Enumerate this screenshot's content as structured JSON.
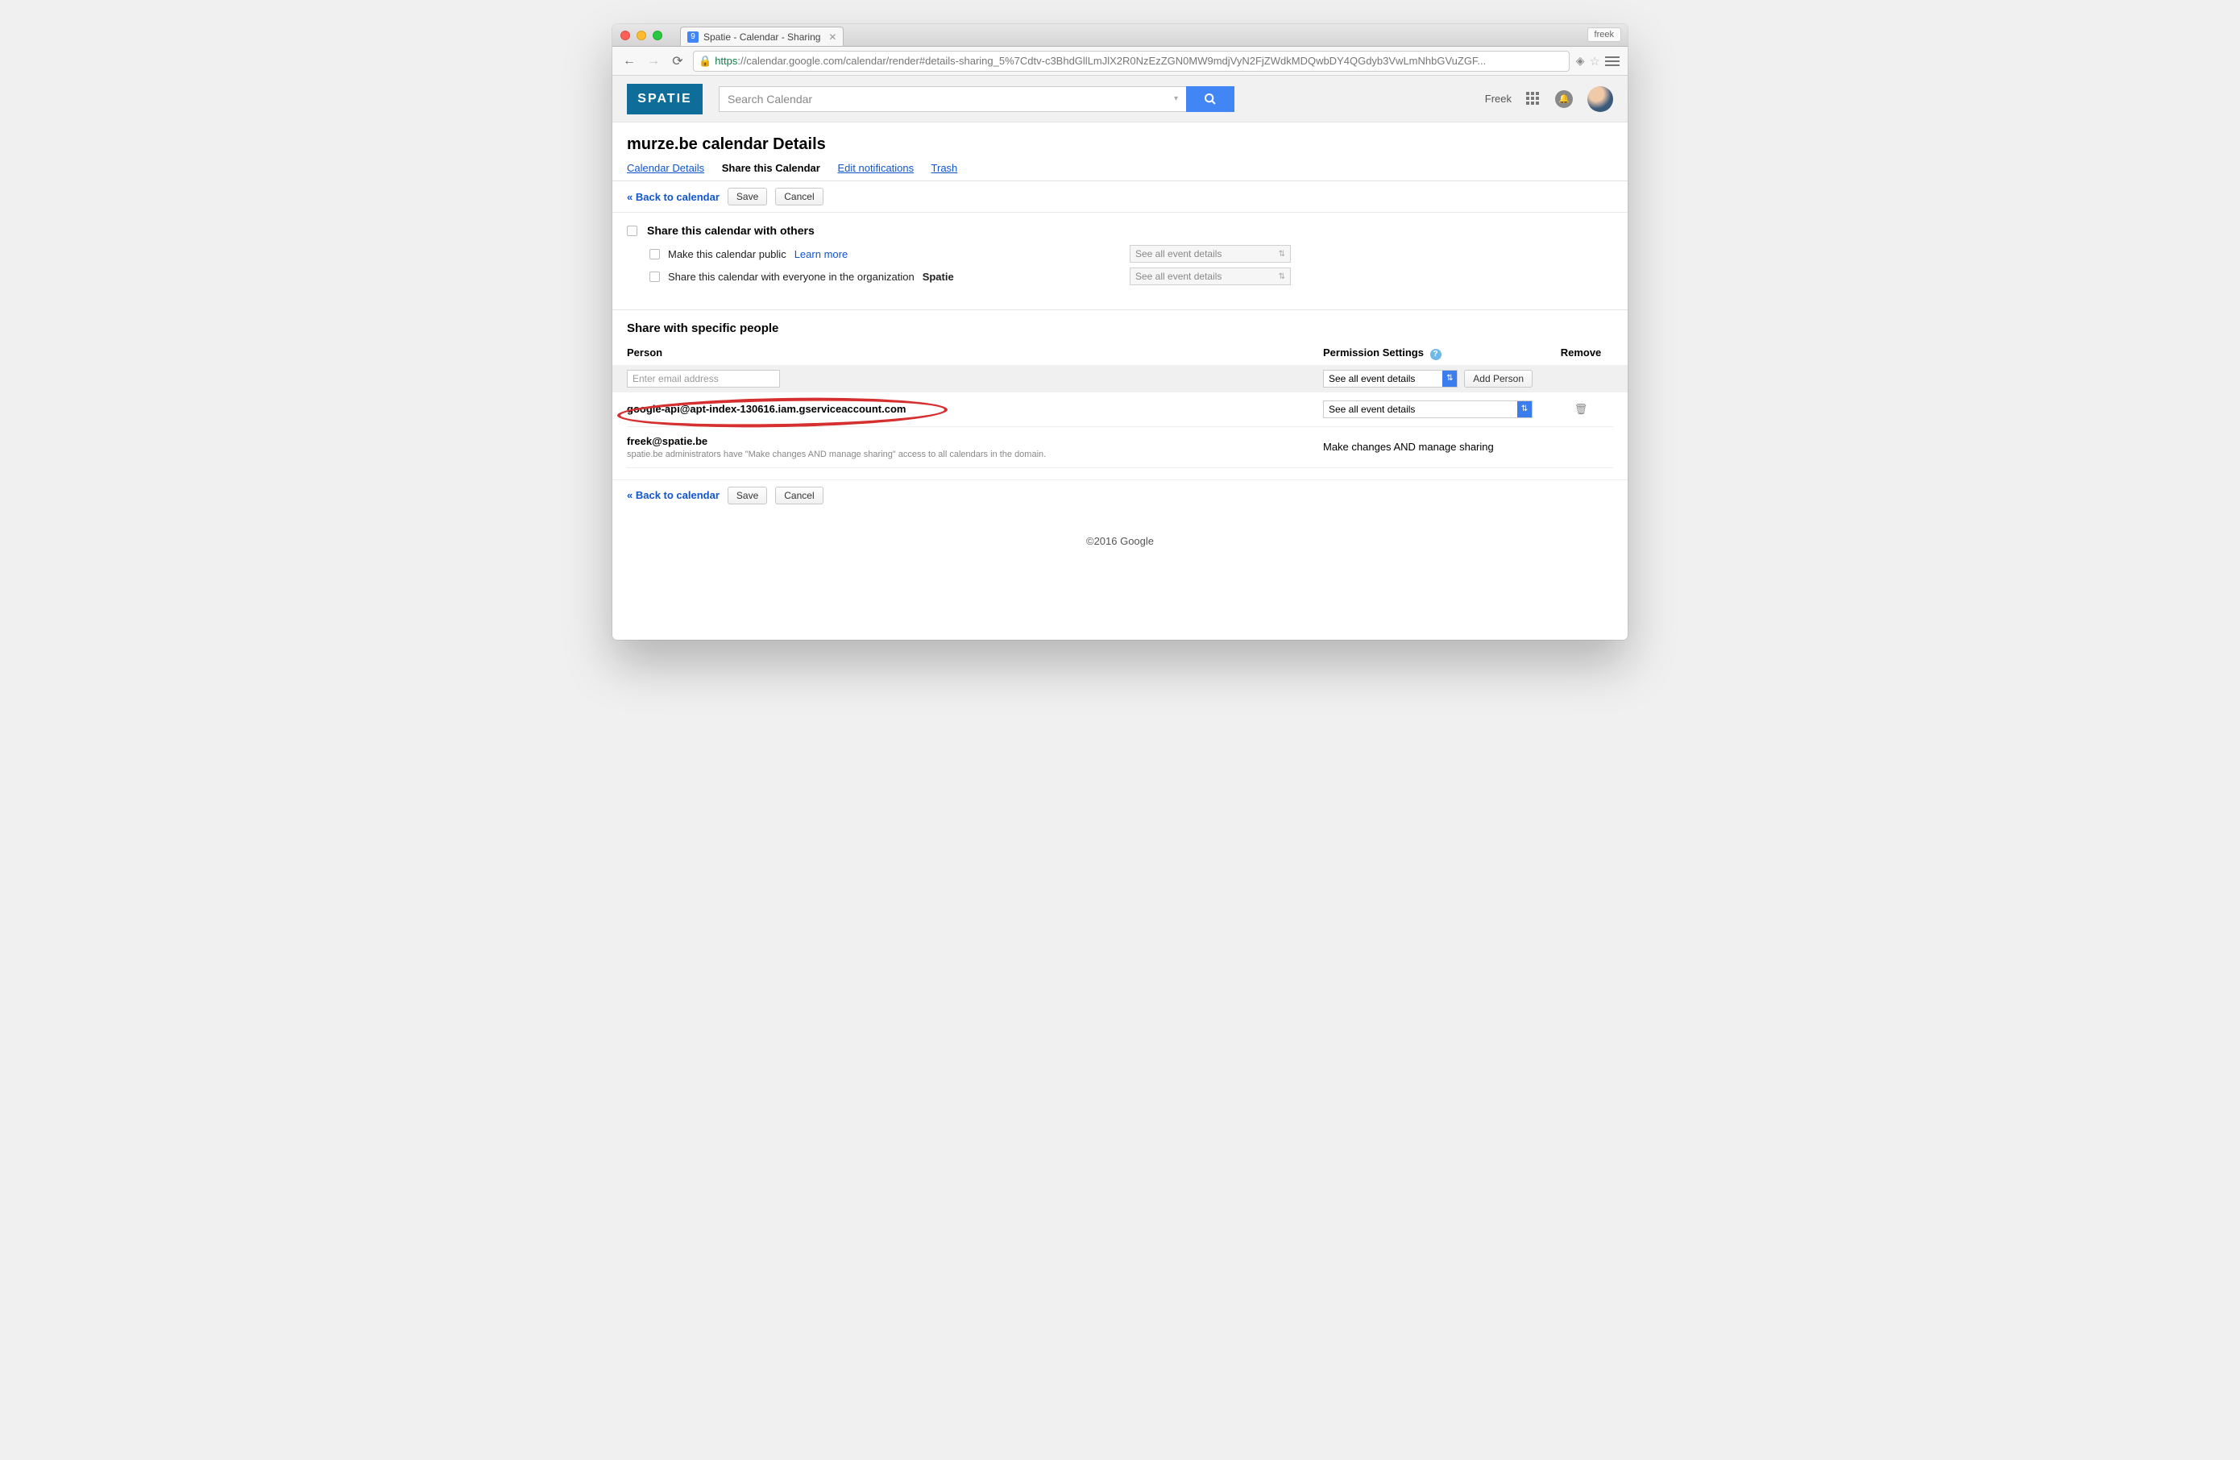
{
  "chrome": {
    "profile_name": "freek",
    "tab": {
      "badge": "9",
      "title": "Spatie - Calendar - Sharing"
    },
    "url_secure_part": "https",
    "url_host": "://calendar.google.com",
    "url_path": "/calendar/render#details-sharing_5%7Cdtv-c3BhdGllLmJlX2R0NzEzZGN0MW9mdjVyN2FjZWdkMDQwbDY4QGdyb3VwLmNhbGVuZGF...",
    "menu": "≡"
  },
  "gcal_header": {
    "logo": "SPATIE",
    "search_placeholder": "Search Calendar",
    "user_label": "Freek"
  },
  "page": {
    "title": "murze.be calendar Details",
    "tabs": {
      "details": "Calendar Details",
      "share": "Share this Calendar",
      "notifications": "Edit notifications",
      "trash": "Trash"
    },
    "back": "« Back to calendar",
    "save": "Save",
    "cancel": "Cancel"
  },
  "share_others": {
    "heading": "Share this calendar with others",
    "opt_public": "Make this calendar public",
    "learn_more": "Learn more",
    "opt_org_prefix": "Share this calendar with everyone in the organization",
    "org_name": "Spatie",
    "select_value": "See all event details"
  },
  "share_people": {
    "heading": "Share with specific people",
    "col_person": "Person",
    "col_permission": "Permission Settings",
    "col_remove": "Remove",
    "email_placeholder": "Enter email address",
    "add_person": "Add Person",
    "default_permission": "See all event details",
    "rows": [
      {
        "email": "google-api@apt-index-130616.iam.gserviceaccount.com",
        "permission": "See all event details",
        "removable": true,
        "highlighted": true
      },
      {
        "email": "freek@spatie.be",
        "permission": "Make changes AND manage sharing",
        "note": "spatie.be administrators have \"Make changes AND manage sharing\" access to all calendars in the domain.",
        "removable": false
      }
    ]
  },
  "footer": "©2016 Google"
}
